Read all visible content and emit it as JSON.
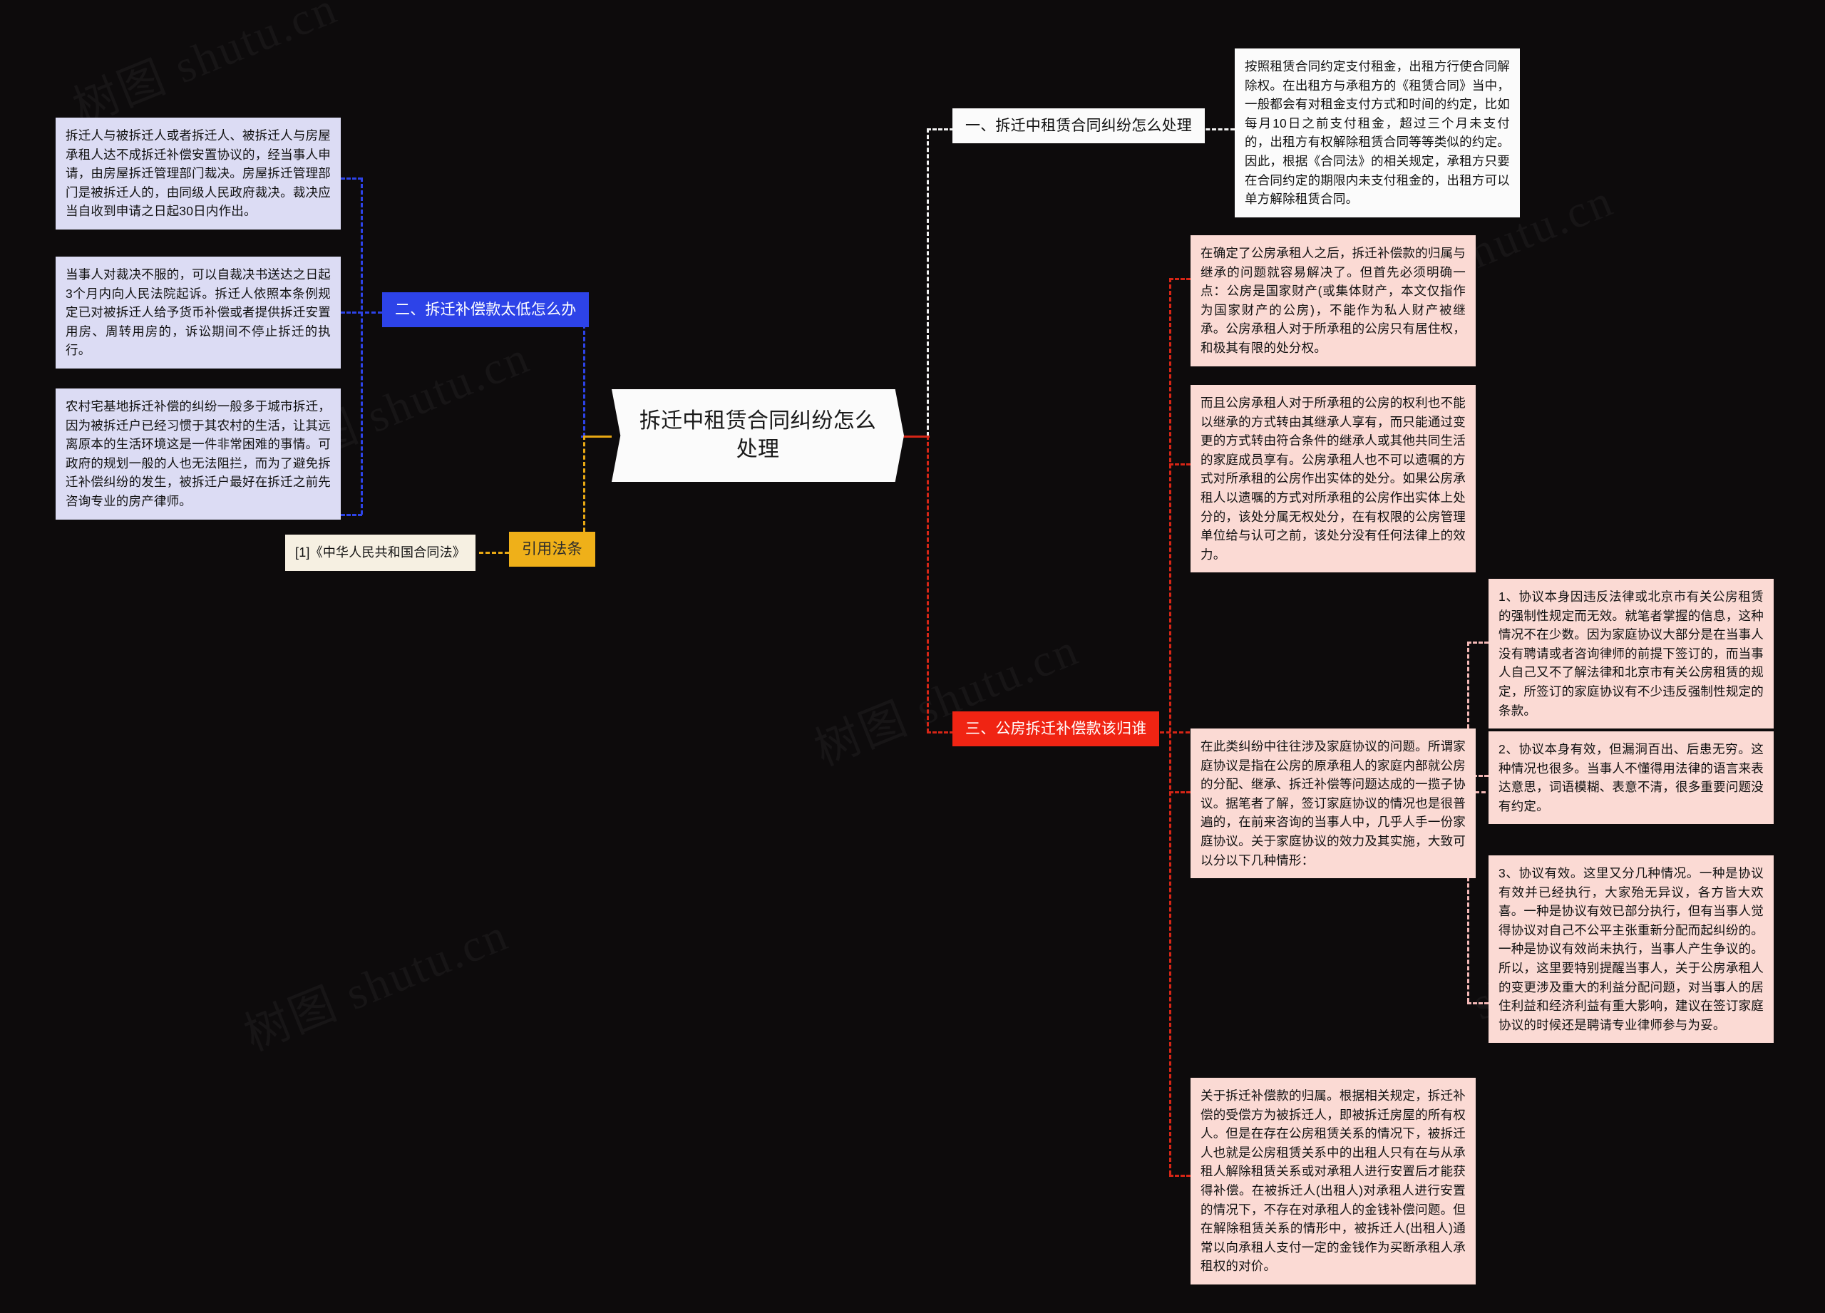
{
  "meta": {
    "background_color": "#0d0b0c",
    "watermark_text": "树图 shutu.cn"
  },
  "central": {
    "title": "拆迁中租赁合同纠纷怎么处理",
    "color": "#fbfbfb"
  },
  "branches": {
    "section_one": {
      "label": "一、拆迁中租赁合同纠纷怎么处理",
      "color": "#fbfbfb",
      "connector_color": "#f2f2f2",
      "children": [
        {
          "text": "按照租赁合同约定支付租金，出租方行使合同解除权。在出租方与承租方的《租赁合同》当中，一般都会有对租金支付方式和时间的约定，比如每月10日之前支付租金，超过三个月未支付的，出租方有权解除租赁合同等等类似的约定。因此，根据《合同法》的相关规定，承租方只要在合同约定的期限内未支付租金的，出租方可以单方解除租赁合同。",
          "color": "#fbfbfb"
        }
      ]
    },
    "section_two": {
      "label": "二、拆迁补偿款太低怎么办",
      "color": "#2d43e8",
      "connector_color": "#2d43e8",
      "children": [
        {
          "text": "拆迁人与被拆迁人或者拆迁人、被拆迁人与房屋承租人达不成拆迁补偿安置协议的，经当事人申请，由房屋拆迁管理部门裁决。房屋拆迁管理部门是被拆迁人的，由同级人民政府裁决。裁决应当自收到申请之日起30日内作出。",
          "color": "#dcdcf4"
        },
        {
          "text": "当事人对裁决不服的，可以自裁决书送达之日起3个月内向人民法院起诉。拆迁人依照本条例规定已对被拆迁人给予货币补偿或者提供拆迁安置用房、周转用房的，诉讼期间不停止拆迁的执行。",
          "color": "#dcdcf4"
        },
        {
          "text": "农村宅基地拆迁补偿的纠纷一般多于城市拆迁，因为被拆迁户已经习惯于其农村的生活，让其远离原本的生活环境这是一件非常困难的事情。可政府的规划一般的人也无法阻拦，而为了避免拆迁补偿纠纷的发生，被拆迁户最好在拆迁之前先咨询专业的房产律师。",
          "color": "#dcdcf4"
        }
      ]
    },
    "section_three": {
      "label": "三、公房拆迁补偿款该归谁",
      "color": "#f02413",
      "connector_color": "#d62516",
      "children": [
        {
          "text": "在确定了公房承租人之后，拆迁补偿款的归属与继承的问题就容易解决了。但首先必须明确一点：公房是国家财产(或集体财产，本文仅指作为国家财产的公房)，不能作为私人财产被继承。公房承租人对于所承租的公房只有居住权，和极其有限的处分权。",
          "color": "#fbdad4"
        },
        {
          "text": "而且公房承租人对于所承租的公房的权利也不能以继承的方式转由其继承人享有，而只能通过变更的方式转由符合条件的继承人或其他共同生活的家庭成员享有。公房承租人也不可以遗嘱的方式对所承租的公房作出实体的处分。如果公房承租人以遗嘱的方式对所承租的公房作出实体上处分的，该处分属无权处分，在有权限的公房管理单位给与认可之前，该处分没有任何法律上的效力。",
          "color": "#fbdad4"
        },
        {
          "text": "在此类纠纷中往往涉及家庭协议的问题。所谓家庭协议是指在公房的原承租人的家庭内部就公房的分配、继承、拆迁补偿等问题达成的一揽子协议。据笔者了解，签订家庭协议的情况也是很普遍的，在前来咨询的当事人中，几乎人手一份家庭协议。关于家庭协议的效力及其实施，大致可以分以下几种情形：",
          "color": "#fbdad4",
          "subchildren": [
            {
              "text": "1、协议本身因违反法律或北京市有关公房租赁的强制性规定而无效。就笔者掌握的信息，这种情况不在少数。因为家庭协议大部分是在当事人没有聘请或者咨询律师的前提下签订的，而当事人自己又不了解法律和北京市有关公房租赁的规定，所签订的家庭协议有不少违反强制性规定的条款。",
              "color": "#fbdad4"
            },
            {
              "text": "2、协议本身有效，但漏洞百出、后患无穷。这种情况也很多。当事人不懂得用法律的语言来表达意思，词语模糊、表意不清，很多重要问题没有约定。",
              "color": "#fbdad4"
            },
            {
              "text": "3、协议有效。这里又分几种情况。一种是协议有效并已经执行，大家殆无异议，各方皆大欢喜。一种是协议有效已部分执行，但有当事人觉得协议对自己不公平主张重新分配而起纠纷的。一种是协议有效尚未执行，当事人产生争议的。所以，这里要特别提醒当事人，关于公房承租人的变更涉及重大的利益分配问题，对当事人的居住利益和经济利益有重大影响，建议在签订家庭协议的时候还是聘请专业律师参与为妥。",
              "color": "#fbdad4"
            }
          ]
        },
        {
          "text": "关于拆迁补偿款的归属。根据相关规定，拆迁补偿的受偿方为被拆迁人，即被拆迁房屋的所有权人。但是在存在公房租赁关系的情况下，被拆迁人也就是公房租赁关系中的出租人只有在与从承租人解除租赁关系或对承租人进行安置后才能获得补偿。在被拆迁人(出租人)对承租人进行安置的情况下，不存在对承租人的金钱补偿问题。但在解除租赁关系的情形中，被拆迁人(出租人)通常以向承租人支付一定的金钱作为买断承租人承租权的对价。",
          "color": "#fbdad4"
        }
      ]
    },
    "citation": {
      "label": "引用法条",
      "color": "#efb019",
      "connector_color": "#e8a813",
      "children": [
        {
          "text": "[1]《中华人民共和国合同法》",
          "color": "#f6f0e2"
        }
      ]
    }
  }
}
